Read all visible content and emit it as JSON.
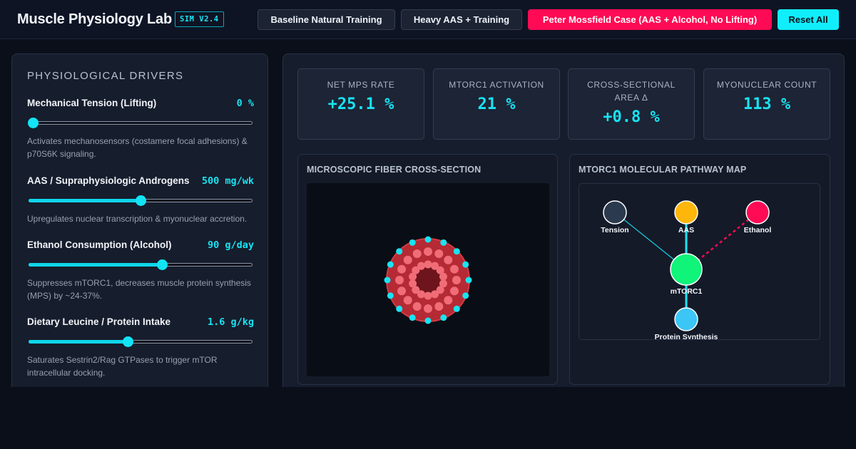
{
  "header": {
    "title": "Muscle Physiology Lab",
    "badge": "SIM V2.4",
    "presets": [
      {
        "label": "Baseline Natural Training"
      },
      {
        "label": "Heavy AAS + Training"
      },
      {
        "label": "Peter Mossfield Case (AAS + Alcohol, No Lifting)"
      }
    ],
    "reset_label": "Reset All"
  },
  "drivers": {
    "heading": "PHYSIOLOGICAL DRIVERS",
    "items": [
      {
        "label": "Mechanical Tension (Lifting)",
        "value": "0 %",
        "level": 0.0,
        "desc": "Activates mechanosensors (costamere focal adhesions) & p70S6K signaling."
      },
      {
        "label": "AAS / Supraphysiologic Androgens",
        "value": "500 mg/wk",
        "level": 0.5,
        "desc": "Upregulates nuclear transcription & myonuclear accretion."
      },
      {
        "label": "Ethanol Consumption (Alcohol)",
        "value": "90 g/day",
        "level": 0.6,
        "desc": "Suppresses mTORC1, decreases muscle protein synthesis (MPS) by ~24-37%."
      },
      {
        "label": "Dietary Leucine / Protein Intake",
        "value": "1.6 g/kg",
        "level": 0.44,
        "desc": "Saturates Sestrin2/Rag GTPases to trigger mTOR intracellular docking."
      }
    ]
  },
  "metrics": [
    {
      "label": "NET MPS RATE",
      "value": "+25.1 %"
    },
    {
      "label": "MTORC1 ACTIVATION",
      "value": "21 %"
    },
    {
      "label": "CROSS-SECTIONAL AREA Δ",
      "value": "+0.8 %"
    },
    {
      "label": "MYONUCLEAR COUNT",
      "value": "113 %"
    }
  ],
  "fiber": {
    "title": "MICROSCOPIC FIBER CROSS-SECTION",
    "colors": {
      "fiber": "#b52a34",
      "core": "#6e141c",
      "myofibril": "#f06d78",
      "satellite": "#19e3f3"
    }
  },
  "pathway": {
    "title": "MTORC1 MOLECULAR PATHWAY MAP",
    "nodes": [
      {
        "id": "tension",
        "label": "Tension",
        "color": "#2b3a4e"
      },
      {
        "id": "aas",
        "label": "AAS",
        "color": "#ffb60a"
      },
      {
        "id": "ethanol",
        "label": "Ethanol",
        "color": "#ff0a55"
      },
      {
        "id": "mtorc1",
        "label": "mTORC1",
        "color": "#10f47a"
      },
      {
        "id": "synthesis",
        "label": "Protein Synthesis",
        "color": "#3bc6f6"
      }
    ]
  }
}
